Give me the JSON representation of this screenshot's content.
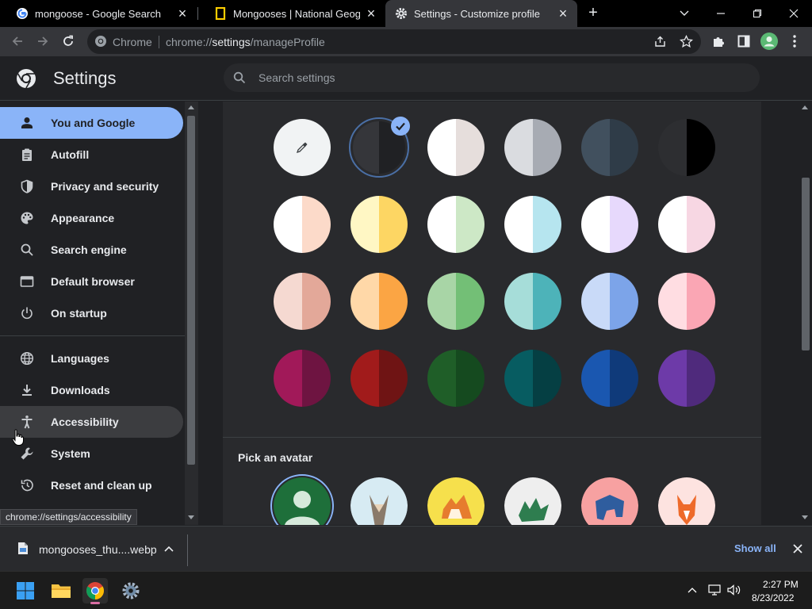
{
  "tabs": [
    {
      "title": "mongoose - Google Search",
      "favicon": "google-icon"
    },
    {
      "title": "Mongooses | National Geograph",
      "favicon": "national-geographic-icon"
    },
    {
      "title": "Settings - Customize profile",
      "favicon": "chrome-settings-icon"
    }
  ],
  "omnibox": {
    "label": "Chrome",
    "url_prefix": "chrome://",
    "url_host": "settings",
    "url_path": "/manageProfile"
  },
  "settings": {
    "title": "Settings",
    "search_placeholder": "Search settings"
  },
  "sidebar": {
    "items": [
      {
        "label": "You and Google",
        "icon": "person-icon"
      },
      {
        "label": "Autofill",
        "icon": "clipboard-icon"
      },
      {
        "label": "Privacy and security",
        "icon": "shield-icon"
      },
      {
        "label": "Appearance",
        "icon": "palette-icon"
      },
      {
        "label": "Search engine",
        "icon": "search-icon"
      },
      {
        "label": "Default browser",
        "icon": "browser-icon"
      },
      {
        "label": "On startup",
        "icon": "power-icon"
      },
      {
        "label": "Languages",
        "icon": "globe-icon"
      },
      {
        "label": "Downloads",
        "icon": "download-icon"
      },
      {
        "label": "Accessibility",
        "icon": "accessibility-icon"
      },
      {
        "label": "System",
        "icon": "wrench-icon"
      },
      {
        "label": "Reset and clean up",
        "icon": "history-icon"
      }
    ]
  },
  "theme_colors": [
    [
      [
        "#f1f3f4",
        "#f1f3f4"
      ],
      [
        "#35363a",
        "#202124"
      ],
      [
        "#ffffff",
        "#e6dedc"
      ],
      [
        "#dadce0",
        "#a7abb3"
      ],
      [
        "#41505e",
        "#2f3c48"
      ],
      [
        "#2d2e31",
        "#000000"
      ]
    ],
    [
      [
        "#ffffff",
        "#fcdac9"
      ],
      [
        "#fff7c4",
        "#fdd663"
      ],
      [
        "#ffffff",
        "#cde8c6"
      ],
      [
        "#ffffff",
        "#b6e5ef"
      ],
      [
        "#ffffff",
        "#e7d9fc"
      ],
      [
        "#ffffff",
        "#f7d7e3"
      ]
    ],
    [
      [
        "#f5d9d1",
        "#e3a899"
      ],
      [
        "#ffd8a8",
        "#fba544"
      ],
      [
        "#a8d5a6",
        "#73bf76"
      ],
      [
        "#a6ddd9",
        "#4db3b9"
      ],
      [
        "#c9daf8",
        "#7ca4e9"
      ],
      [
        "#ffdde2",
        "#faa6b4"
      ]
    ],
    [
      [
        "#a11959",
        "#6e1441"
      ],
      [
        "#a11b1b",
        "#6f1414"
      ],
      [
        "#1f5e28",
        "#154a1f"
      ],
      [
        "#075c61",
        "#053f43"
      ],
      [
        "#1a57b0",
        "#0f3a7a"
      ],
      [
        "#6d3aa8",
        "#4f2a7c"
      ]
    ]
  ],
  "avatar_section": {
    "heading": "Pick an avatar",
    "avatars": [
      "default-avatar-icon",
      "origami-cat-icon",
      "origami-corgi-icon",
      "origami-dragon-icon",
      "origami-elephant-icon",
      "origami-fox-icon"
    ]
  },
  "status_bubble": "chrome://settings/accessibility",
  "downloads": {
    "file_name": "mongooses_thu....webp",
    "show_all": "Show all"
  },
  "taskbar": {
    "time": "2:27 PM",
    "date": "8/23/2022"
  },
  "colors": {
    "accent": "#8ab4f8",
    "background": "#202124",
    "card": "#292a2d"
  }
}
